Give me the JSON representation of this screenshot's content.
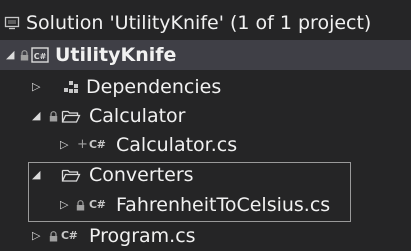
{
  "solution": {
    "label": "Solution 'UtilityKnife' (1 of 1 project)"
  },
  "project": {
    "label": "UtilityKnife",
    "type_badge": "C#"
  },
  "nodes": [
    {
      "label": "Dependencies"
    },
    {
      "label": "Calculator"
    },
    {
      "label": "Calculator.cs",
      "badge": "C#"
    },
    {
      "label": "Converters"
    },
    {
      "label": "FahrenheitToCelsius.cs",
      "badge": "C#"
    },
    {
      "label": "Program.cs",
      "badge": "C#"
    }
  ],
  "glyphs": {
    "expanded": "◢",
    "collapsed": "▷",
    "lock": "🔒",
    "plus": "+"
  },
  "colors": {
    "background": "#252526",
    "selected_row": "#3f3f46",
    "text": "#f1f1f1",
    "highlight_border": "#9a9a9a"
  }
}
